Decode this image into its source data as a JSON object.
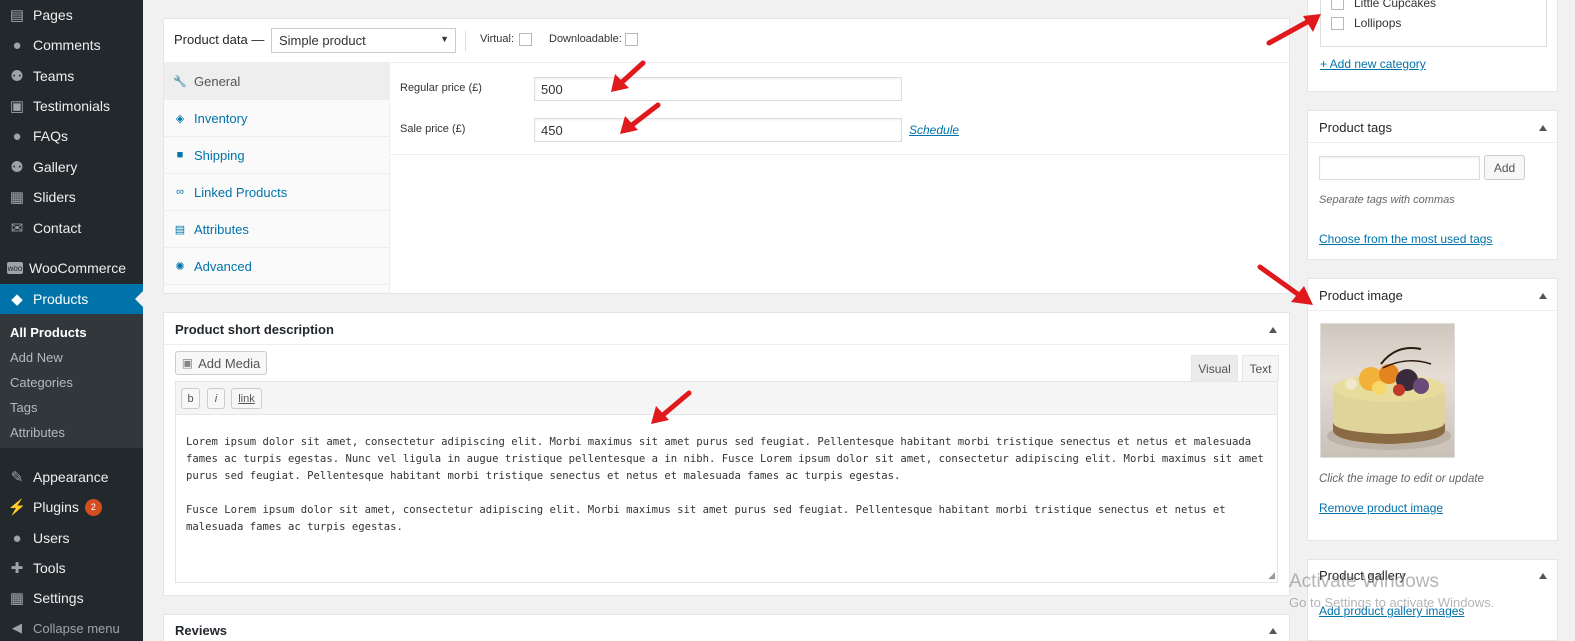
{
  "sidebar": {
    "items": [
      {
        "label": "Pages",
        "icon": "pages-icon"
      },
      {
        "label": "Comments",
        "icon": "comments-icon"
      },
      {
        "label": "Teams",
        "icon": "teams-icon"
      },
      {
        "label": "Testimonials",
        "icon": "testimonials-icon"
      },
      {
        "label": "FAQs",
        "icon": "faqs-icon"
      },
      {
        "label": "Gallery",
        "icon": "gallery-icon"
      },
      {
        "label": "Sliders",
        "icon": "sliders-icon"
      },
      {
        "label": "Contact",
        "icon": "mail-icon"
      },
      {
        "label": "WooCommerce",
        "icon": "woocommerce-icon"
      },
      {
        "label": "Products",
        "icon": "products-icon"
      },
      {
        "label": "Appearance",
        "icon": "appearance-icon"
      },
      {
        "label": "Plugins",
        "icon": "plugins-icon",
        "badge": "2"
      },
      {
        "label": "Users",
        "icon": "users-icon"
      },
      {
        "label": "Tools",
        "icon": "tools-icon"
      },
      {
        "label": "Settings",
        "icon": "settings-icon"
      }
    ],
    "submenu": [
      "All Products",
      "Add New",
      "Categories",
      "Tags",
      "Attributes"
    ],
    "collapse_label": "Collapse menu"
  },
  "product_data": {
    "title": "Product data —",
    "type_select": "Simple product",
    "virtual_label": "Virtual:",
    "downloadable_label": "Downloadable:",
    "tabs": [
      "General",
      "Inventory",
      "Shipping",
      "Linked Products",
      "Attributes",
      "Advanced"
    ],
    "regular_price_label": "Regular price (£)",
    "regular_price_value": "500",
    "sale_price_label": "Sale price (£)",
    "sale_price_value": "450",
    "schedule_link": "Schedule"
  },
  "short_description": {
    "title": "Product short description",
    "add_media": "Add Media",
    "visual_tab": "Visual",
    "text_tab": "Text",
    "quicktags": [
      "b",
      "i",
      "link"
    ],
    "paragraph1": "Lorem ipsum dolor sit amet, consectetur adipiscing elit. Morbi maximus sit amet purus sed feugiat. Pellentesque habitant morbi tristique senectus et netus et malesuada fames ac turpis egestas. Nunc vel ligula in augue tristique pellentesque a in nibh. Fusce Lorem ipsum dolor sit amet, consectetur adipiscing elit. Morbi maximus sit amet purus sed feugiat. Pellentesque habitant morbi tristique senectus et netus et malesuada fames ac turpis egestas.",
    "paragraph2": "Fusce Lorem ipsum dolor sit amet, consectetur adipiscing elit. Morbi maximus sit amet purus sed feugiat. Pellentesque habitant morbi tristique senectus et netus et malesuada fames ac turpis egestas."
  },
  "reviews": {
    "title": "Reviews"
  },
  "categories": {
    "items": [
      "Little Cupcakes",
      "Lollipops"
    ],
    "add_new": "+ Add new category"
  },
  "product_tags": {
    "title": "Product tags",
    "add_button": "Add",
    "hint": "Separate tags with commas",
    "choose_link": "Choose from the most used tags"
  },
  "product_image": {
    "title": "Product image",
    "hint": "Click the image to edit or update",
    "remove_link": "Remove product image"
  },
  "product_gallery": {
    "title": "Product gallery",
    "add_link": "Add product gallery images"
  },
  "watermark": {
    "line1": "Activate Windows",
    "line2": "Go to Settings to activate Windows."
  },
  "colors": {
    "accent": "#0073aa",
    "sidebar": "#23282d",
    "arrow": "#e0191c"
  }
}
